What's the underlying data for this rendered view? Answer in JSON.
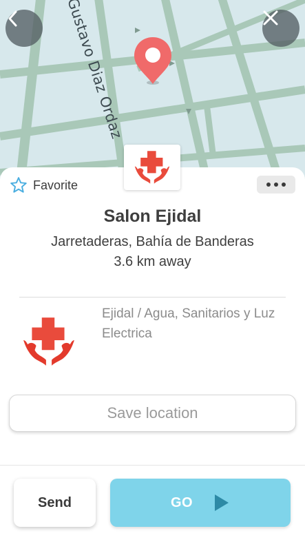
{
  "map": {
    "street_label": "Gustavo Diaz Ordaz",
    "back_icon": "chevron-left-icon",
    "close_icon": "close-icon",
    "pin_icon": "map-pin-icon",
    "pin_color": "#f06a6a",
    "water_color": "#d7e8ec",
    "road_color": "#a9c8b8"
  },
  "place": {
    "favorite_label": "Favorite",
    "favorite_icon": "star-outline-icon",
    "more_icon": "more-horizontal-icon",
    "category_icon": "medical-cross-hands-icon",
    "name": "Salon Ejidal",
    "address": "Jarretaderas, Bahía de Banderas",
    "distance": "3.6 km away",
    "description": "Ejidal / Agua, Sanitarios y Luz Electrica"
  },
  "actions": {
    "save_label": "Save location",
    "send_label": "Send",
    "go_label": "GO",
    "go_icon": "play-icon",
    "go_color": "#7fd4ea",
    "accent_red": "#e33a2c"
  }
}
